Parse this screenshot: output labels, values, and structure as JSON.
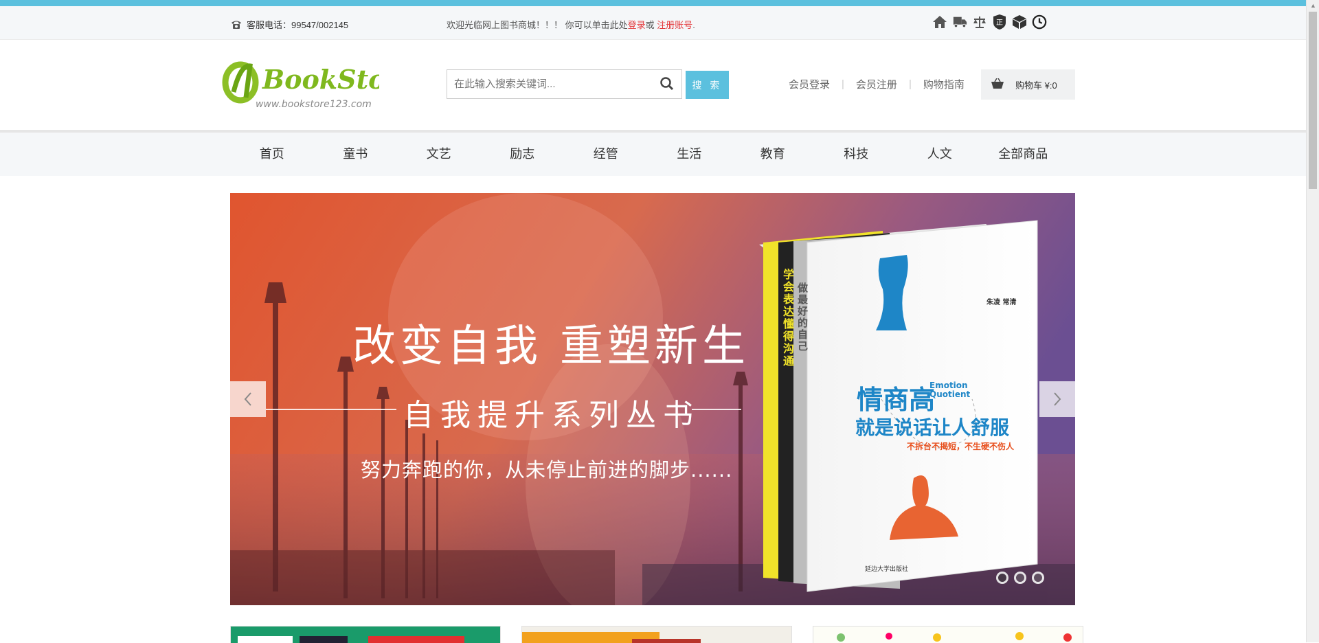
{
  "topbar": {
    "phone_label": "客服电话：99547/002145",
    "welcome_prefix": "欢迎光临网上图书商城！！！ 你可以单击此处",
    "login_link": "登录",
    "or_text": "或 ",
    "register_link": "注册账号",
    "period": "."
  },
  "logo": {
    "brand": "BookStore",
    "url": "www.bookstore123.com"
  },
  "search": {
    "placeholder": "在此输入搜索关键词...",
    "button_label": "搜 索"
  },
  "user_links": [
    "会员登录",
    "会员注册",
    "购物指南"
  ],
  "cart": {
    "label": "购物车 ¥:0"
  },
  "nav": [
    "首页",
    "童书",
    "文艺",
    "励志",
    "经管",
    "生活",
    "教育",
    "科技",
    "人文",
    "全部商品"
  ],
  "banner": {
    "title": "改变自我 重塑新生",
    "subtitle": "自我提升系列丛书",
    "desc": "努力奔跑的你，从未停止前进的脚步......",
    "book_main_title": "情商高",
    "book_main_sub": "就是说话让人舒服",
    "book_en": "Emotion Quotient",
    "book_tag": "不拆台不揭短，不生硬不伤人",
    "book_author": "朱凌 常清",
    "book_publisher": "延边大学出版社",
    "book_spine_1": "学会表达 懂得沟通",
    "book_spine_2": "做最好的自己",
    "slide_count": 3,
    "active_slide": 1
  },
  "colors": {
    "accent": "#5bc0de",
    "link_red": "#e4393c",
    "nav_bg": "#f5f7f9"
  }
}
